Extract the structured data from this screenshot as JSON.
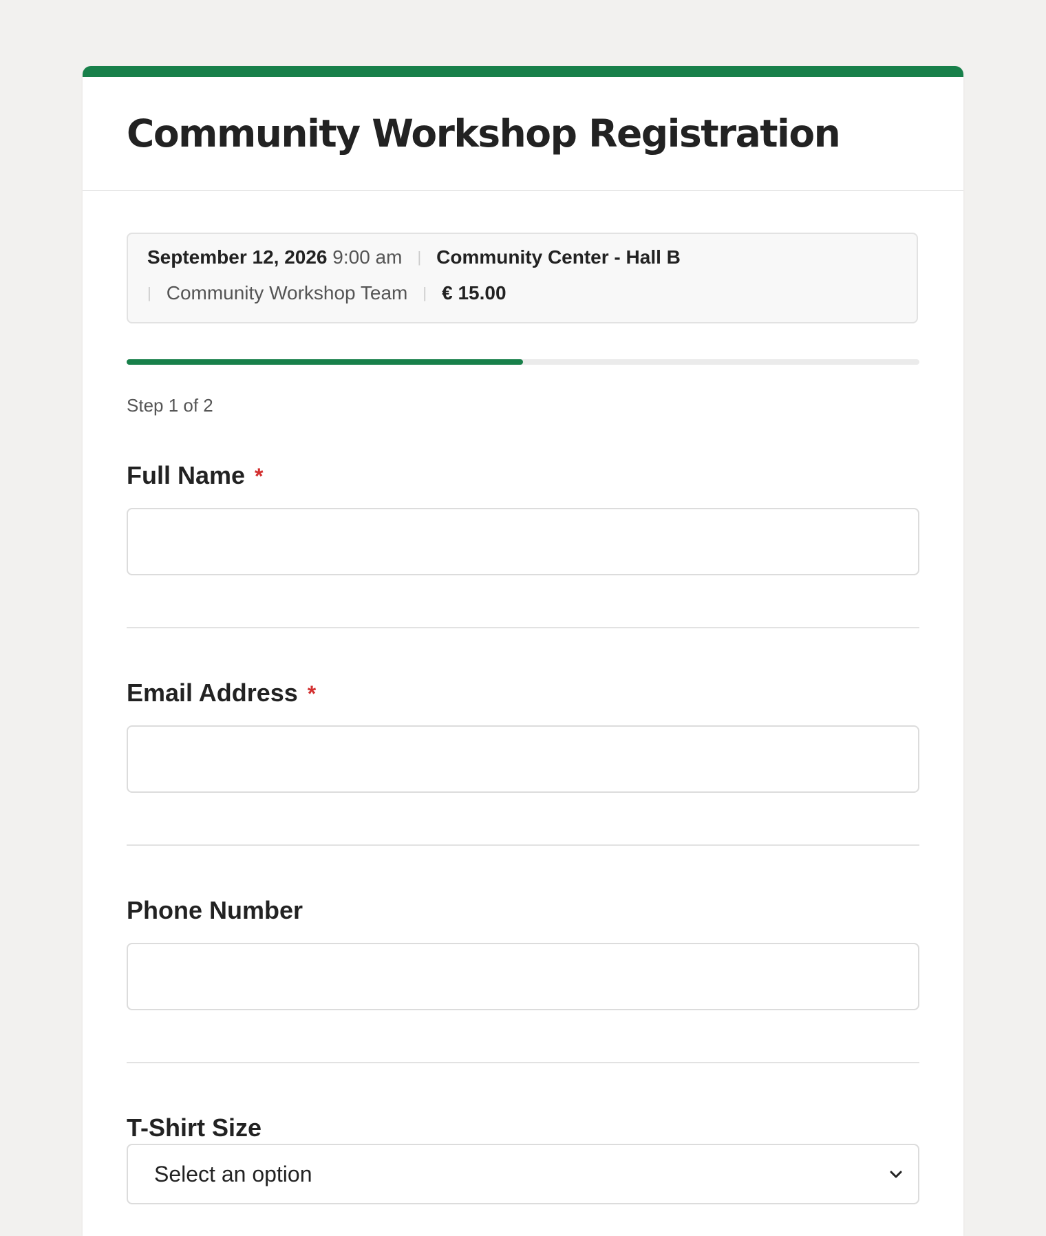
{
  "form": {
    "title": "Community Workshop Registration",
    "accent_color": "#18804a",
    "required_color": "#d32f2f"
  },
  "event": {
    "date": "September 12, 2026",
    "time": "9:00 am",
    "location": "Community Center - Hall B",
    "organizer": "Community Workshop Team",
    "price": "€ 15.00"
  },
  "progress": {
    "step_text": "Step 1 of 2",
    "current_step": 1,
    "total_steps": 2
  },
  "fields": {
    "full_name": {
      "label": "Full Name",
      "required_mark": "*",
      "value": ""
    },
    "email": {
      "label": "Email Address",
      "required_mark": "*",
      "value": ""
    },
    "phone": {
      "label": "Phone Number",
      "value": ""
    },
    "tshirt": {
      "label": "T-Shirt Size",
      "selected": "Select an option",
      "icon": "chevron-down-icon"
    }
  }
}
